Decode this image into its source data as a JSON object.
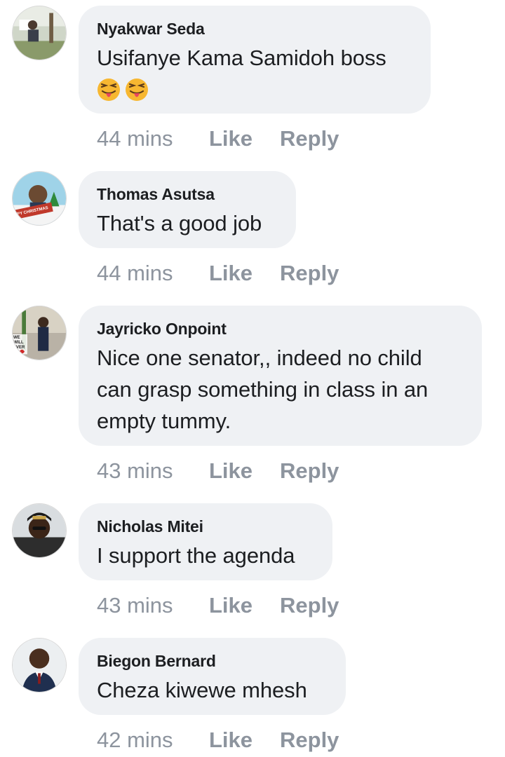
{
  "comments": [
    {
      "author": "Nyakwar Seda",
      "text": "Usifanye Kama Samidoh boss",
      "emojis": [
        "winking-face-with-tongue",
        "winking-face-with-tongue"
      ],
      "time": "44 mins",
      "like_label": "Like",
      "reply_label": "Reply"
    },
    {
      "author": "Thomas Asutsa",
      "text": "That's a good job",
      "avatar_text": "PPY CHRISTMAS",
      "time": "44 mins",
      "like_label": "Like",
      "reply_label": "Reply"
    },
    {
      "author": "Jayricko Onpoint",
      "text_lines": [
        "Nice one senator,, indeed no child",
        "can grasp something in class in an",
        "empty tummy."
      ],
      "avatar_text": "WE WILL EVER",
      "time": "43 mins",
      "like_label": "Like",
      "reply_label": "Reply"
    },
    {
      "author": "Nicholas Mitei",
      "text": "I support the agenda",
      "time": "43 mins",
      "like_label": "Like",
      "reply_label": "Reply"
    },
    {
      "author": "Biegon Bernard",
      "text": "Cheza kiwewe mhesh",
      "time": "42 mins",
      "like_label": "Like",
      "reply_label": "Reply"
    }
  ],
  "colors": {
    "bubble_bg": "#eff1f4",
    "author_text": "#1c1e21",
    "meta_text": "#8d949e",
    "emoji_face": "#f7b731"
  }
}
